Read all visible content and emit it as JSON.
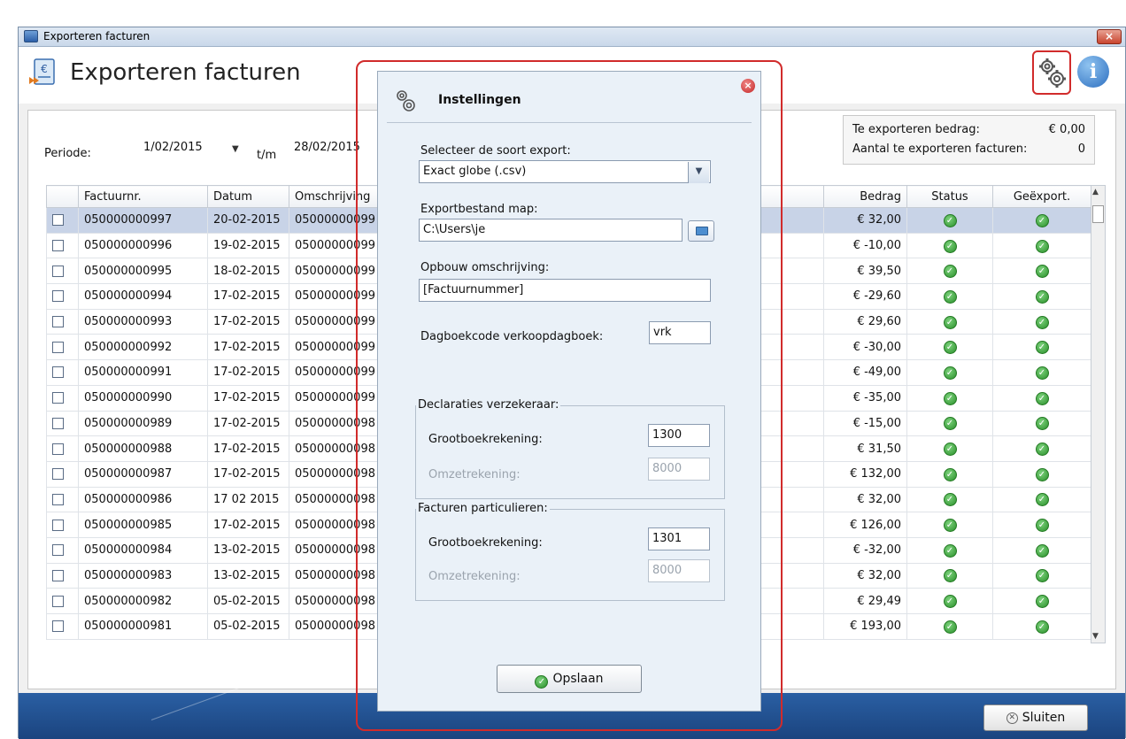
{
  "window": {
    "title": "Exporteren facturen",
    "close_label": "×"
  },
  "header": {
    "title": "Exporteren facturen",
    "info_label": "i"
  },
  "filters": {
    "periode_label": "Periode:",
    "from": "1/02/2015",
    "tm_label": "t/m",
    "to": "28/02/2015"
  },
  "summary": {
    "amount_label": "Te exporteren bedrag:",
    "amount_value": "€ 0,00",
    "count_label": "Aantal te exporteren facturen:",
    "count_value": "0"
  },
  "table": {
    "columns": [
      "",
      "Factuurnr.",
      "Datum",
      "Omschrijving",
      "",
      "Bedrag",
      "Status",
      "Geëxport."
    ],
    "rows": [
      {
        "nr": "050000000997",
        "datum": "20-02-2015",
        "oms": "05000000099",
        "bedrag": "€ 32,00"
      },
      {
        "nr": "050000000996",
        "datum": "19-02-2015",
        "oms": "05000000099",
        "bedrag": "€ -10,00"
      },
      {
        "nr": "050000000995",
        "datum": "18-02-2015",
        "oms": "05000000099",
        "bedrag": "€ 39,50"
      },
      {
        "nr": "050000000994",
        "datum": "17-02-2015",
        "oms": "05000000099",
        "bedrag": "€ -29,60"
      },
      {
        "nr": "050000000993",
        "datum": "17-02-2015",
        "oms": "05000000099",
        "bedrag": "€ 29,60"
      },
      {
        "nr": "050000000992",
        "datum": "17-02-2015",
        "oms": "05000000099",
        "bedrag": "€ -30,00"
      },
      {
        "nr": "050000000991",
        "datum": "17-02-2015",
        "oms": "05000000099",
        "bedrag": "€ -49,00"
      },
      {
        "nr": "050000000990",
        "datum": "17-02-2015",
        "oms": "05000000099",
        "bedrag": "€ -35,00"
      },
      {
        "nr": "050000000989",
        "datum": "17-02-2015",
        "oms": "05000000098",
        "bedrag": "€ -15,00"
      },
      {
        "nr": "050000000988",
        "datum": "17-02-2015",
        "oms": "05000000098",
        "bedrag": "€ 31,50"
      },
      {
        "nr": "050000000987",
        "datum": "17-02-2015",
        "oms": "05000000098",
        "bedrag": "€ 132,00"
      },
      {
        "nr": "050000000986",
        "datum": "17 02 2015",
        "oms": "05000000098",
        "bedrag": "€ 32,00"
      },
      {
        "nr": "050000000985",
        "datum": "17-02-2015",
        "oms": "05000000098",
        "bedrag": "€ 126,00"
      },
      {
        "nr": "050000000984",
        "datum": "13-02-2015",
        "oms": "05000000098",
        "bedrag": "€ -32,00"
      },
      {
        "nr": "050000000983",
        "datum": "13-02-2015",
        "oms": "05000000098",
        "bedrag": "€ 32,00"
      },
      {
        "nr": "050000000982",
        "datum": "05-02-2015",
        "oms": "05000000098",
        "bedrag": "€ 29,49"
      },
      {
        "nr": "050000000981",
        "datum": "05-02-2015",
        "oms": "05000000098",
        "bedrag": "€ 193,00"
      }
    ]
  },
  "footer": {
    "close_button": "Sluiten"
  },
  "dialog": {
    "title": "Instellingen",
    "export_type_label": "Selecteer de soort export:",
    "export_type_value": "Exact globe (.csv)",
    "folder_label": "Exportbestand map:",
    "folder_value": "C:\\Users\\je",
    "description_label": "Opbouw omschrijving:",
    "description_value": "[Factuurnummer]",
    "journal_label": "Dagboekcode verkoopdagboek:",
    "journal_value": "vrk",
    "group1": {
      "title": "Declaraties verzekeraar:",
      "ledger_label": "Grootboekrekening:",
      "ledger_value": "1300",
      "revenue_label": "Omzetrekening:",
      "revenue_value": "8000"
    },
    "group2": {
      "title": "Facturen particulieren:",
      "ledger_label": "Grootboekrekening:",
      "ledger_value": "1301",
      "revenue_label": "Omzetrekening:",
      "revenue_value": "8000"
    },
    "save_button": "Opslaan"
  }
}
